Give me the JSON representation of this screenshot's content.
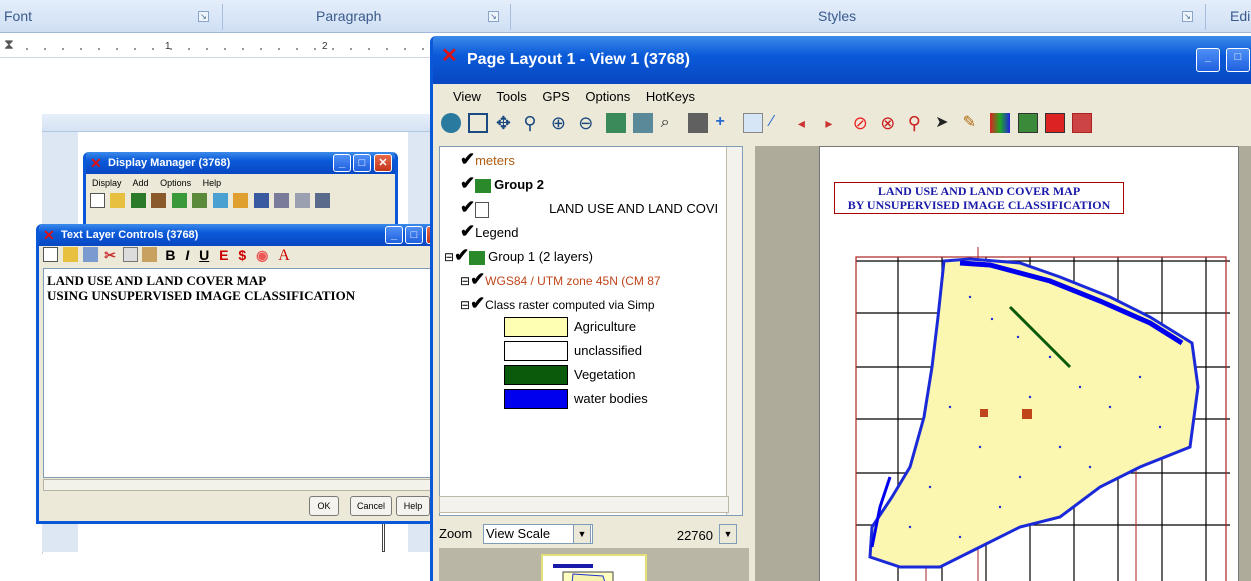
{
  "ribbon": {
    "groups": [
      "Font",
      "Paragraph",
      "Styles",
      "Edi"
    ]
  },
  "ruler": {
    "marks": [
      "1",
      "2"
    ]
  },
  "display_manager": {
    "title": "Display Manager (3768)",
    "menu": [
      "Display",
      "Add",
      "Options",
      "Help"
    ]
  },
  "text_layer_controls": {
    "title": "Text Layer Controls (3768)",
    "format_labels": [
      "B",
      "I",
      "U",
      "E",
      "A"
    ],
    "text_line1": "LAND USE AND LAND COVER MAP",
    "text_line2": "USING UNSUPERVISED IMAGE CLASSIFICATION",
    "buttons": [
      "OK",
      "Cancel",
      "Help"
    ]
  },
  "page_layout": {
    "title": "Page Layout 1 - View 1 (3768)",
    "menu": [
      "View",
      "Tools",
      "GPS",
      "Options",
      "HotKeys"
    ],
    "layers": [
      {
        "label": "meters"
      },
      {
        "label": "Group 2"
      },
      {
        "label": "LAND USE AND LAND COVI"
      },
      {
        "label": "Legend"
      },
      {
        "label": "Group 1  (2 layers)"
      },
      {
        "label": "WGS84 / UTM zone 45N (CM 87"
      },
      {
        "label": "Class raster computed via Simp"
      }
    ],
    "classes": [
      {
        "label": "Agriculture",
        "color": "#ffffb3"
      },
      {
        "label": "unclassified",
        "color": "#ffffff"
      },
      {
        "label": "Vegetation",
        "color": "#0b5a0b"
      },
      {
        "label": "water bodies",
        "color": "#0000ee"
      }
    ],
    "zoom_label": "Zoom",
    "zoom_mode": "View Scale",
    "zoom_value": "22760",
    "map_title_line1": "LAND USE AND LAND COVER MAP",
    "map_title_line2": "BY UNSUPERVISED IMAGE CLASSIFICATION"
  }
}
